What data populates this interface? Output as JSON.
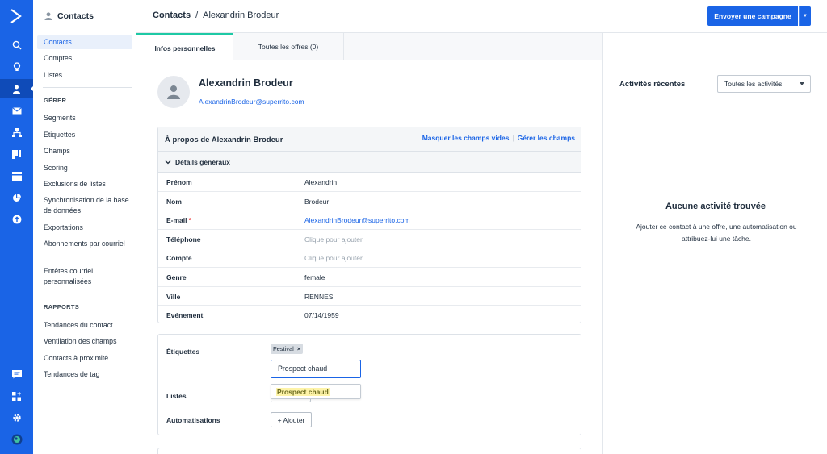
{
  "app": {
    "section_title": "Contacts"
  },
  "sidebar": {
    "items_main": [
      {
        "label": "Contacts",
        "active": true
      },
      {
        "label": "Comptes"
      },
      {
        "label": "Listes"
      }
    ],
    "section_gerer": "GÉRER",
    "items_gerer": [
      {
        "label": "Segments"
      },
      {
        "label": "Étiquettes"
      },
      {
        "label": "Champs"
      },
      {
        "label": "Scoring"
      },
      {
        "label": "Exclusions de listes"
      },
      {
        "label": "Synchronisation de la base de données"
      },
      {
        "label": "Exportations"
      },
      {
        "label": "Abonnements par courriel"
      },
      {
        "label": "Entêtes courriel personnalisées"
      }
    ],
    "section_rapports": "RAPPORTS",
    "items_rapports": [
      {
        "label": "Tendances du contact"
      },
      {
        "label": "Ventilation des champs"
      },
      {
        "label": "Contacts à proximité"
      },
      {
        "label": "Tendances de tag"
      }
    ]
  },
  "header": {
    "breadcrumb_root": "Contacts",
    "breadcrumb_sep": "/",
    "breadcrumb_current": "Alexandrin Brodeur",
    "campaign_button": "Envoyer une campagne"
  },
  "tabs": [
    {
      "label": "Infos personnelles",
      "active": true
    },
    {
      "label": "Toutes les offres (0)"
    }
  ],
  "contact": {
    "name": "Alexandrin Brodeur",
    "email": "AlexandrinBrodeur@superrito.com"
  },
  "about": {
    "title": "À propos de Alexandrin Brodeur",
    "link_hide": "Masquer les champs vides",
    "link_sep": "|",
    "link_manage": "Gérer les champs",
    "section": "Détails généraux",
    "fields": [
      {
        "label": "Prénom",
        "value": "Alexandrin"
      },
      {
        "label": "Nom",
        "value": "Brodeur"
      },
      {
        "label": "E-mail",
        "required": "*",
        "value": "AlexandrinBrodeur@superrito.com"
      },
      {
        "label": "Téléphone",
        "value": "Clique pour ajouter"
      },
      {
        "label": "Compte",
        "value": "Clique pour ajouter"
      },
      {
        "label": "Genre",
        "value": "female"
      },
      {
        "label": "Ville",
        "value": "RENNES"
      },
      {
        "label": "Evénement",
        "value": "07/14/1959"
      }
    ]
  },
  "tags_card": {
    "tags_label": "Étiquettes",
    "tag_chip": "Festival",
    "tag_remove": "×",
    "tag_input_value": "Prospect chaud",
    "suggestion": "Prospect chaud",
    "lists_label": "Listes",
    "automations_label": "Automatisations",
    "add_button": "+ Ajouter"
  },
  "activity": {
    "title": "Activités récentes",
    "filter_value": "Toutes les activités",
    "empty_title": "Aucune activité trouvée",
    "empty_hint": "Ajouter ce contact à une offre, une automatisation ou attribuez-lui une tâche."
  },
  "colors": {
    "primary": "#1a64e6",
    "tab_accent": "#1ec9a5",
    "highlight": "#fdf3a8"
  }
}
